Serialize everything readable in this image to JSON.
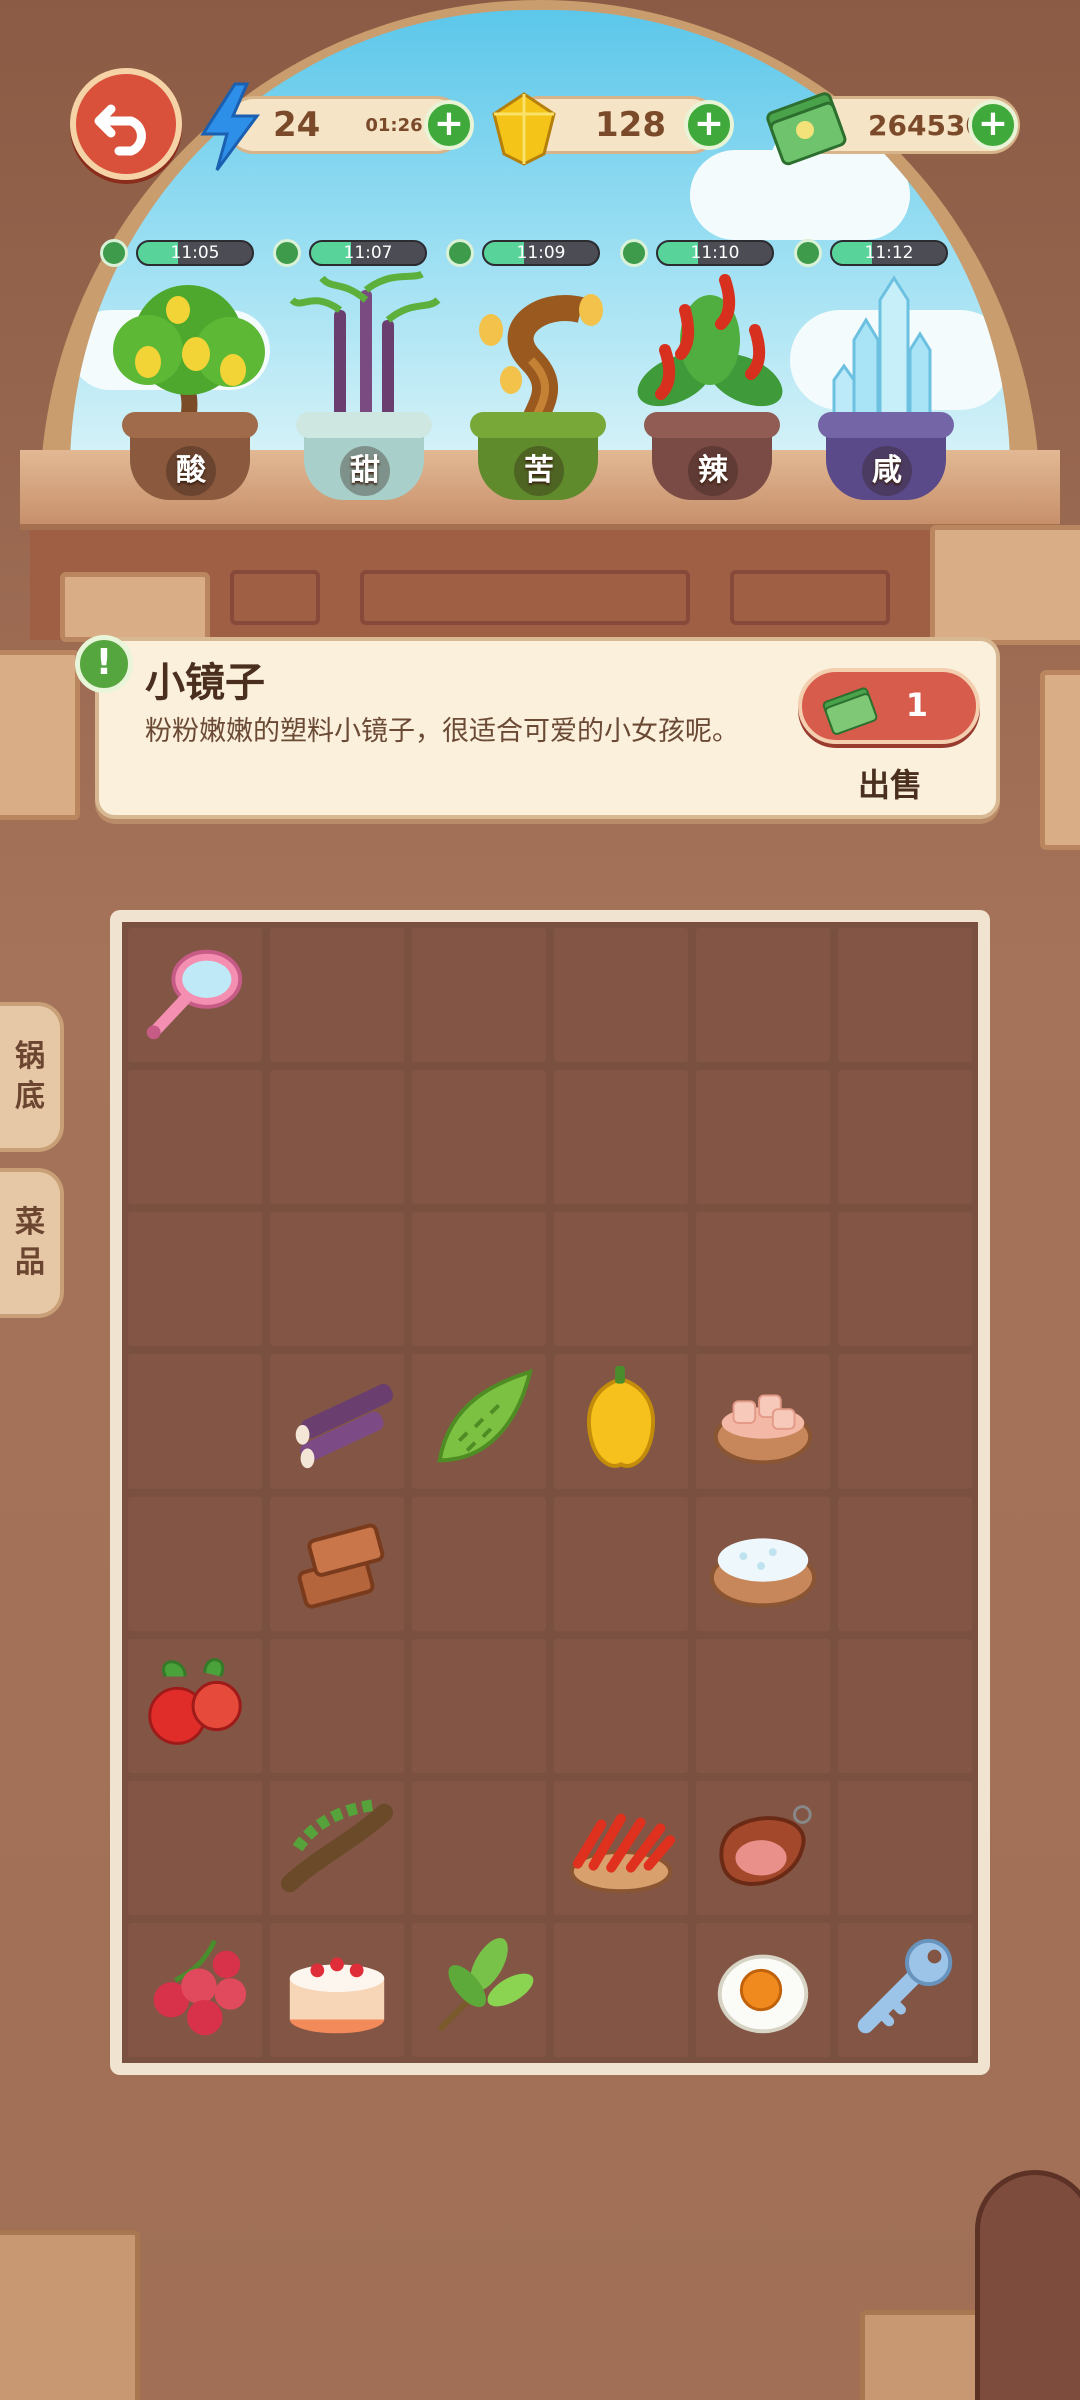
{
  "topbar": {
    "energy": "24",
    "energy_timer": "01:26",
    "gems": "128",
    "cash": "264530"
  },
  "plants": [
    {
      "timer": "11:05",
      "label": "酸",
      "icon": "lemon-tree-icon",
      "progress": 0.35
    },
    {
      "timer": "11:07",
      "label": "甜",
      "icon": "sugarcane-plant-icon",
      "progress": 0.35
    },
    {
      "timer": "11:09",
      "label": "苦",
      "icon": "bitter-tree-icon",
      "progress": 0.35
    },
    {
      "timer": "11:10",
      "label": "辣",
      "icon": "chili-plant-icon",
      "progress": 0.35
    },
    {
      "timer": "11:12",
      "label": "咸",
      "icon": "salt-crystal-icon",
      "progress": 0.35
    }
  ],
  "item": {
    "title": "小镜子",
    "description": "粉粉嫩嫩的塑料小镜子，很适合可爱的小女孩呢。",
    "price": "1",
    "sell_label": "出售"
  },
  "side_tabs": [
    {
      "label_top": "锅",
      "label_bottom": "底"
    },
    {
      "label_top": "菜",
      "label_bottom": "品"
    }
  ],
  "inventory": [
    [
      "mirror-icon",
      "",
      "",
      "",
      "",
      ""
    ],
    [
      "",
      "",
      "",
      "",
      "",
      ""
    ],
    [
      "",
      "",
      "",
      "",
      "",
      ""
    ],
    [
      "",
      "sugarcane-icon",
      "bitter-melon-icon",
      "yellow-pepper-icon",
      "meat-bowl-icon",
      ""
    ],
    [
      "",
      "brown-sugar-icon",
      "",
      "",
      "salt-bowl-icon",
      ""
    ],
    [
      "hawthorn-icon",
      "",
      "",
      "",
      "",
      ""
    ],
    [
      "",
      "tamarind-icon",
      "",
      "chili-basket-icon",
      "cured-meat-icon",
      ""
    ],
    [
      "lychee-icon",
      "cake-icon",
      "tea-leaves-icon",
      "",
      "salted-egg-icon",
      "key-icon"
    ]
  ],
  "colors": {
    "accent_green": "#3faa3b",
    "back_button": "#d9513a",
    "sell_button": "#d85c4c"
  }
}
